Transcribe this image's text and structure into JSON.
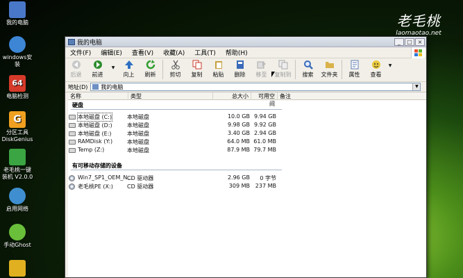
{
  "desktop": {
    "icons": [
      {
        "label": "我的电脑",
        "color": "#4a78c8"
      },
      {
        "label": "windows安装",
        "color": "#3d86d6"
      },
      {
        "label": "电脑检测",
        "color": "#d63a2a"
      },
      {
        "label": "分区工具 DiskGenius",
        "color": "#f0a020"
      },
      {
        "label": "老毛桃一键 装机 V2.0.0",
        "color": "#3aa542"
      },
      {
        "label": "启用网络",
        "color": "#3f8fd0"
      },
      {
        "label": "手动Ghost",
        "color": "#6abf3a"
      },
      {
        "label": "",
        "color": "#e0b020"
      }
    ],
    "logo_text": "老毛桃",
    "logo_url": "laomaotao.net"
  },
  "window": {
    "title": "我的电脑",
    "menu": [
      "文件(F)",
      "编辑(E)",
      "查看(V)",
      "收藏(A)",
      "工具(T)",
      "帮助(H)"
    ],
    "toolbar": [
      {
        "label": "后退",
        "icon": "back-arrow-icon",
        "color": "#aaaaaa",
        "enabled": false
      },
      {
        "label": "前进",
        "icon": "forward-arrow-icon",
        "color": "#2e8d2e",
        "enabled": true
      },
      {
        "label": "向上",
        "icon": "up-arrow-icon",
        "color": "#2e6fc2",
        "enabled": true
      },
      {
        "label": "刷新",
        "icon": "refresh-icon",
        "color": "#2e9e2e",
        "enabled": true
      },
      {
        "label": "剪切",
        "icon": "scissors-icon",
        "color": "#666666",
        "enabled": true
      },
      {
        "label": "复制",
        "icon": "copy-icon",
        "color": "#cc3a2a",
        "enabled": true
      },
      {
        "label": "粘贴",
        "icon": "paste-icon",
        "color": "#c8a040",
        "enabled": true
      },
      {
        "label": "删除",
        "icon": "delete-icon",
        "color": "#3a6ab8",
        "enabled": true
      },
      {
        "label": "移至",
        "icon": "move-to-icon",
        "color": "#aaaaaa",
        "enabled": false
      },
      {
        "label": "复制到",
        "icon": "copy-to-icon",
        "color": "#aaaaaa",
        "enabled": false
      },
      {
        "label": "搜索",
        "icon": "search-icon",
        "color": "#3a6ab8",
        "enabled": true
      },
      {
        "label": "文件夹",
        "icon": "folders-icon",
        "color": "#d9b24a",
        "enabled": true
      },
      {
        "label": "属性",
        "icon": "properties-icon",
        "color": "#5a78b0",
        "enabled": true
      },
      {
        "label": "查看",
        "icon": "view-icon",
        "color": "#e8c83a",
        "enabled": true
      }
    ],
    "address_label": "地址(D)",
    "address_value": "我的电脑",
    "columns": [
      "名称",
      "类型",
      "总大小",
      "可用空间",
      "备注"
    ],
    "groups": [
      {
        "title": "硬盘",
        "rows": [
          {
            "name": "本地磁盘 (C:)",
            "type": "本地磁盘",
            "total": "10.0 GB",
            "free": "9.94 GB"
          },
          {
            "name": "本地磁盘 (D:)",
            "type": "本地磁盘",
            "total": "9.98 GB",
            "free": "9.92 GB"
          },
          {
            "name": "本地磁盘 (E:)",
            "type": "本地磁盘",
            "total": "3.40 GB",
            "free": "2.94 GB"
          },
          {
            "name": "RAMDisk (Y:)",
            "type": "本地磁盘",
            "total": "64.0 MB",
            "free": "61.0 MB"
          },
          {
            "name": "Temp (Z:)",
            "type": "本地磁盘",
            "total": "87.9 MB",
            "free": "79.7 MB"
          }
        ]
      },
      {
        "title": "有可移动存储的设备",
        "rows": [
          {
            "name": "Win7_SP1_OEM_N...",
            "type": "CD 驱动器",
            "total": "2.96 GB",
            "free": "0 字节"
          },
          {
            "name": "老毛桃PE (X:)",
            "type": "CD 驱动器",
            "total": "309 MB",
            "free": "237 MB"
          }
        ]
      }
    ]
  }
}
